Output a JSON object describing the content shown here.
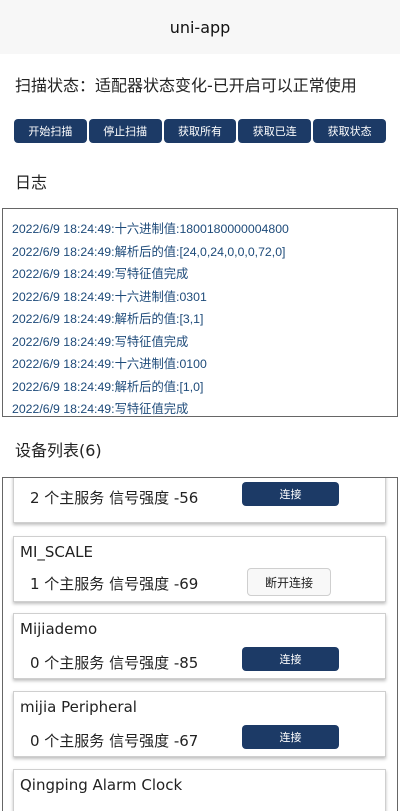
{
  "navbar": {
    "title": "uni-app"
  },
  "status": {
    "text": "扫描状态：适配器状态变化-已开启可以正常使用"
  },
  "buttons": [
    "开始扫描",
    "停止扫描",
    "获取所有",
    "获取已连",
    "获取状态"
  ],
  "log": {
    "title": "日志",
    "lines": [
      "2022/6/9 18:24:49:十六进制值:1800180000004800",
      "2022/6/9 18:24:49:解析后的值:[24,0,24,0,0,0,72,0]",
      "2022/6/9 18:24:49:写特征值完成",
      "2022/6/9 18:24:49:十六进制值:0301",
      "2022/6/9 18:24:49:解析后的值:[3,1]",
      "2022/6/9 18:24:49:写特征值完成",
      "2022/6/9 18:24:49:十六进制值:0100",
      "2022/6/9 18:24:49:解析后的值:[1,0]",
      "2022/6/9 18:24:49:写特征值完成"
    ]
  },
  "devices": {
    "title": "设备列表(6)",
    "items": [
      {
        "name": "",
        "info": "2 个主服务 信号强度 -56",
        "button": "连接"
      },
      {
        "name": "MI_SCALE",
        "info": "1 个主服务 信号强度 -69",
        "button": "断开连接"
      },
      {
        "name": "Mijiademo",
        "info": "0 个主服务 信号强度 -85",
        "button": "连接"
      },
      {
        "name": "mijia Peripheral",
        "info": "0 个主服务 信号强度 -67",
        "button": "连接"
      },
      {
        "name": "Qingping Alarm Clock",
        "info": "",
        "button": ""
      }
    ]
  }
}
